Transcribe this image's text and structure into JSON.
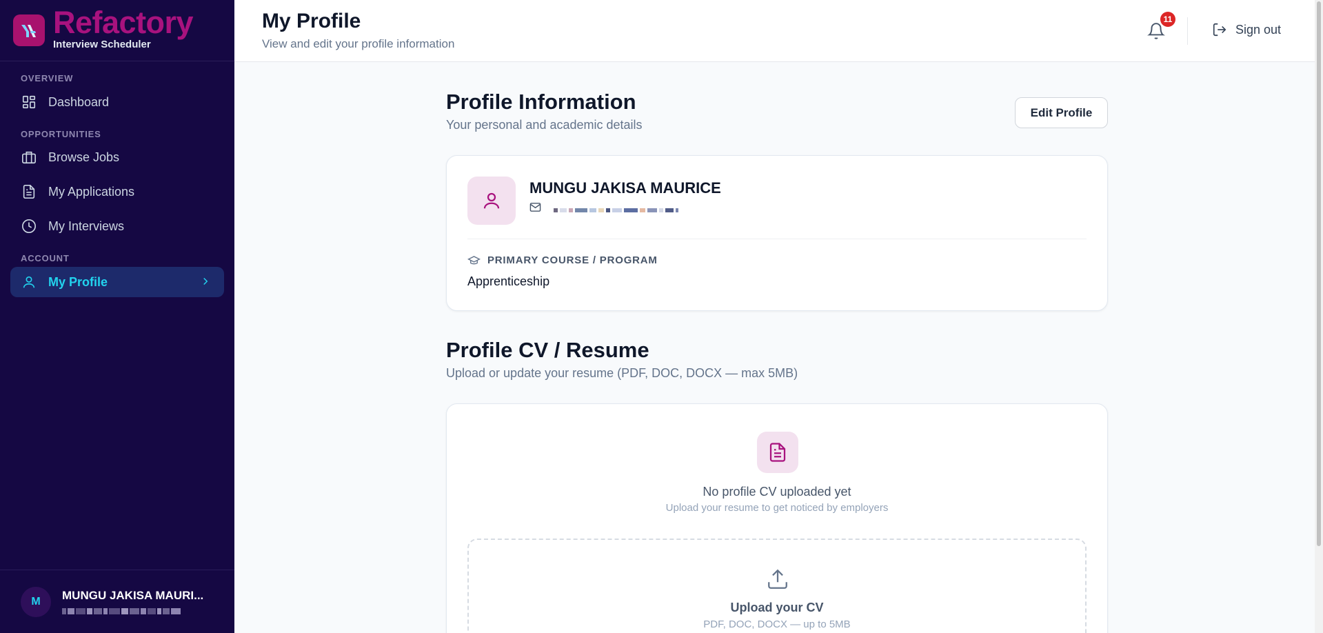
{
  "app": {
    "name": "Refactory",
    "subtitle": "Interview Scheduler",
    "logo_text": "YA"
  },
  "colors": {
    "sidebar_bg": "#150843",
    "brand": "#a8127e",
    "active_text": "#22d3ee",
    "badge": "#dc2626"
  },
  "sidebar": {
    "sections": [
      {
        "label": "OVERVIEW",
        "items": [
          {
            "label": "Dashboard",
            "icon": "dashboard-icon"
          }
        ]
      },
      {
        "label": "OPPORTUNITIES",
        "items": [
          {
            "label": "Browse Jobs",
            "icon": "briefcase-icon"
          },
          {
            "label": "My Applications",
            "icon": "document-icon"
          },
          {
            "label": "My Interviews",
            "icon": "clock-icon"
          }
        ]
      },
      {
        "label": "ACCOUNT",
        "items": [
          {
            "label": "My Profile",
            "icon": "user-icon",
            "active": true
          }
        ]
      }
    ],
    "user": {
      "initial": "M",
      "name": "MUNGU JAKISA MAURI..."
    }
  },
  "header": {
    "title": "My Profile",
    "subtitle": "View and edit your profile information",
    "notification_count": "11",
    "signout_label": "Sign out"
  },
  "profile_info": {
    "title": "Profile Information",
    "subtitle": "Your personal and academic details",
    "edit_label": "Edit Profile",
    "name": "MUNGU JAKISA MAURICE",
    "course_label": "PRIMARY COURSE / PROGRAM",
    "course_value": "Apprenticeship"
  },
  "cv": {
    "title": "Profile CV / Resume",
    "subtitle": "Upload or update your resume (PDF, DOC, DOCX — max 5MB)",
    "empty_title": "No profile CV uploaded yet",
    "empty_sub": "Upload your resume to get noticed by employers",
    "upload_title": "Upload your CV",
    "upload_sub": "PDF, DOC, DOCX — up to 5MB"
  }
}
